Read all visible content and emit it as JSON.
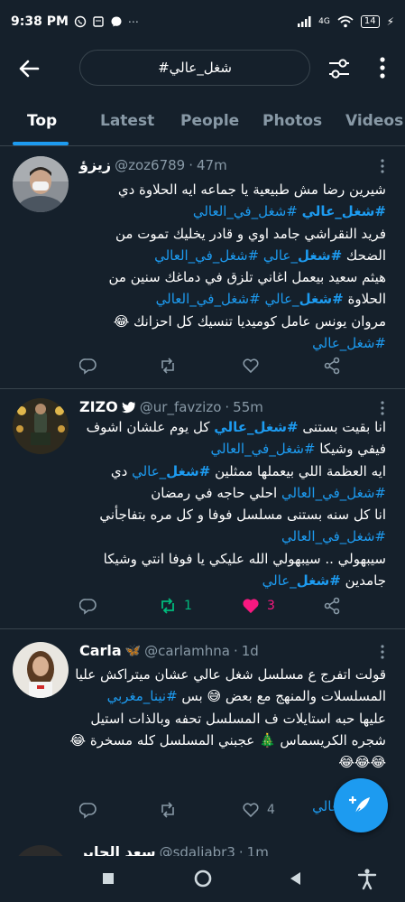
{
  "status_bar": {
    "time": "9:38 PM",
    "network": "4G",
    "battery": "14"
  },
  "search": {
    "query": "#شغل_عالي"
  },
  "tabs": [
    "Top",
    "Latest",
    "People",
    "Photos",
    "Videos"
  ],
  "tweets": [
    {
      "name": "زيزؤ",
      "handle": "@zoz6789",
      "time": "47m",
      "lines": [
        [
          {
            "t": "شيرين رضا مش طبيعية يا جماعه ايه الحلاوة دي"
          }
        ],
        [
          {
            "t": "#شغل_عالي",
            "h": true,
            "b": true
          },
          {
            "t": " "
          },
          {
            "t": "#شغل_في_العالي",
            "h": true
          }
        ],
        [
          {
            "t": "فريد النقراشي جامد اوي و قادر يخليك تموت من"
          }
        ],
        [
          {
            "t": "الضحك "
          },
          {
            "t": "#شغل",
            "h": true,
            "b": true
          },
          {
            "t": "_عالي ",
            "h": true
          },
          {
            "t": "#شغل_في_العالي",
            "h": true
          }
        ],
        [
          {
            "t": "هيثم سعيد بيعمل اغاني تلزق في دماغك سنين من"
          }
        ],
        [
          {
            "t": "الحلاوة "
          },
          {
            "t": "#شغل",
            "h": true,
            "b": true
          },
          {
            "t": "_عالي ",
            "h": true
          },
          {
            "t": "#شغل_في_العالي",
            "h": true
          }
        ],
        [
          {
            "t": "مروان يونس عامل كوميديا تنسيك كل احزانك 😂"
          }
        ],
        [
          {
            "t": "#شغل_عالي",
            "h": true
          }
        ]
      ],
      "replies": "",
      "retweets": "",
      "likes": ""
    },
    {
      "name": "ZIZO",
      "handle": "@ur_favzizo",
      "time": "55m",
      "lines": [
        [
          {
            "t": "انا بقيت بستنى "
          },
          {
            "t": "#شغل_عالي",
            "h": true,
            "b": true
          },
          {
            "t": " كل يوم علشان اشوف"
          }
        ],
        [
          {
            "t": "فيفي وشيكا "
          },
          {
            "t": "#شغل_في_العالي",
            "h": true
          }
        ],
        [
          {
            "t": "ايه العظمة اللي بيعملها ممثلين "
          },
          {
            "t": "#شغل",
            "h": true,
            "b": true
          },
          {
            "t": "_عالي",
            "h": true
          },
          {
            "t": " دي"
          }
        ],
        [
          {
            "t": "#شغل_في_العالي",
            "h": true
          },
          {
            "t": " احلي حاجه في رمضان"
          }
        ],
        [
          {
            "t": "انا كل سنه بستنى مسلسل فوفا و كل مره بتفاجأني"
          }
        ],
        [
          {
            "t": "#شغل_في_العالي",
            "h": true
          }
        ],
        [
          {
            "t": "سيبهولي .. سيبهولي الله عليكي يا فوفا انتي وشيكا"
          }
        ],
        [
          {
            "t": "جامدين "
          },
          {
            "t": "#شغل",
            "h": true,
            "b": true
          },
          {
            "t": "_عالي",
            "h": true
          }
        ]
      ],
      "replies": "",
      "retweets": "1",
      "likes": "3"
    },
    {
      "name": "Carla",
      "handle": "@carlamhna",
      "time": "1d",
      "lines": [
        [
          {
            "t": "قولت اتفرج ع مسلسل شغل عالي عشان ميتراكش عليا"
          }
        ],
        [
          {
            "t": "المسلسلات والمنهج مع بعض 😅 بس "
          },
          {
            "t": "#نينا_مغربي",
            "h": true
          }
        ],
        [
          {
            "t": "عليها حبه استايلات ف المسلسل تحفه وبالذات استيل"
          }
        ],
        [
          {
            "t": "شجره الكريسماس 🎄 عجبني المسلسل كله مسخرة 😂"
          }
        ],
        [
          {
            "t": "😂😂😂"
          }
        ],
        [
          {
            "t": ""
          }
        ],
        [
          {
            "t": "#شغل_عالي",
            "h": true
          }
        ]
      ],
      "replies": "",
      "retweets": "",
      "likes": "4"
    }
  ],
  "partial_tweet": {
    "name": "سعد الجابر",
    "handle": "@sdaljabr3",
    "time": "1m"
  },
  "colors": {
    "background": "#15202b",
    "accent": "#1d9bf0",
    "muted": "#8899a6",
    "border": "#38444d",
    "retweet_active": "#00ba7c",
    "like_active": "#f91880"
  }
}
